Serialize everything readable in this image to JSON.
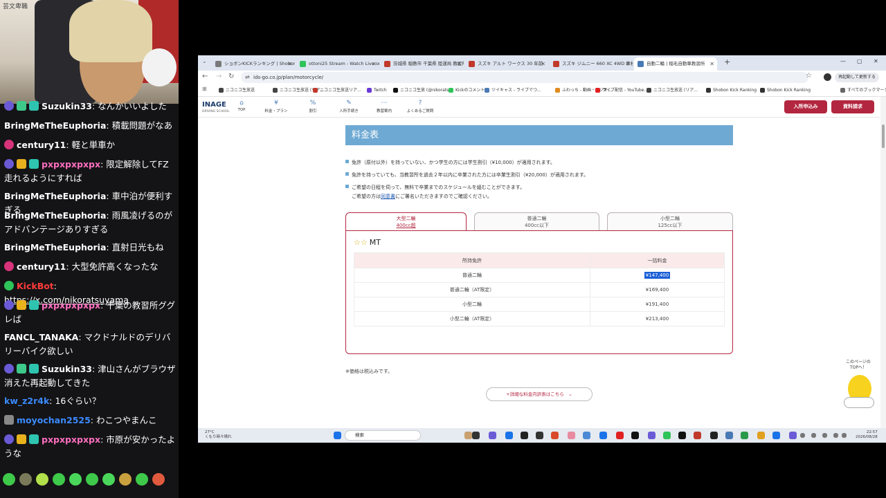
{
  "cam": {
    "tag": "芸文卑職"
  },
  "chat": [
    {
      "top": 0,
      "user": "Suzukin33",
      "text": "なんかいいよした",
      "badges": [
        "#2a8a3a",
        "#8a4ad6"
      ],
      "ucolor": "#ffffff"
    },
    {
      "user": "BringMeTheEuphoria",
      "text": "積載問題がなあ",
      "ucolor": "#ffffff"
    },
    {
      "user": "century11",
      "text": "軽と単車か",
      "ucolor": "#ffffff",
      "circle": "#d6337a"
    },
    {
      "user": "pxpxpxpxpx",
      "text": "限定解除してFZ走れるようにすれば",
      "ucolor": "#ff6fbf"
    },
    {
      "user": "BringMeTheEuphoria",
      "text": "車中泊が便利すぎる",
      "ucolor": "#ffffff"
    },
    {
      "user": "BringMeTheEuphoria",
      "text": "雨風凌げるのがアドバンテージありすぎる",
      "ucolor": "#ffffff"
    },
    {
      "user": "BringMeTheEuphoria",
      "text": "直射日光もね",
      "ucolor": "#ffffff"
    },
    {
      "user": "century11",
      "text": "大型免許高くなったな",
      "ucolor": "#ffffff"
    },
    {
      "user": "KickBot",
      "text": "https://x.com/nikoratsuyama",
      "ucolor": "#ff3b3b"
    },
    {
      "user": "pxpxpxpxpx",
      "text": "千葉の教習所ググレば",
      "ucolor": "#ff6fbf"
    },
    {
      "user": "FANCL_TANAKA",
      "text": "マクドナルドのデリバリーバイク欲しい",
      "ucolor": "#ffffff"
    },
    {
      "user": "Suzukin33",
      "text": "津山さんがブラウザ消えた再起動してきた",
      "ucolor": "#ffffff"
    },
    {
      "user": "kw_z2r4k",
      "text": "16ぐらい？",
      "ucolor": "#3b8bff"
    },
    {
      "user": "moyochan2525",
      "text": "わこつやまんこ",
      "ucolor": "#3b8bff"
    },
    {
      "user": "pxpxpxpxpx",
      "text": "市原が安かったような",
      "ucolor": "#ff6fbf"
    }
  ],
  "browser": {
    "tabs": [
      "ショボンKICKランキング | Shobon Kick",
      "ottoni25 Stream - Watch Live on Kick",
      "茨城県 稲敷市 千葉県 陸運局 教習所",
      "スズキ アルト ワークス 30 年前",
      "スズキ ジムニー 660 XC 4WD 車検",
      "自動二輪 | 稲毛自動車教習所"
    ],
    "url": "ids-go.co.jp/plan/motorcycle/",
    "relaunch": "再起動して更新する",
    "bookmarks": [
      "ニコニコ生放送",
      "ニコニコ生放送 (リア...",
      "ニコニコ生放送リア...",
      "Twitch",
      "ニコニコ生放 (@nikorats...",
      "Kickのコメント",
      "ツイキャス - ライブでつ...",
      "ふわっち - 動画・ラジオ...",
      "ライブ配信 - YouTube...",
      "ニコニコ生放送 (リア...",
      "Shobon Kick Ranking",
      "Shobon Kick Ranking",
      "すべてのブックマーク"
    ],
    "site": {
      "logo": "INAGE",
      "logo_sub": "DRIVING SCHOOL",
      "nav": [
        "TOP",
        "料金・プラン",
        "割引",
        "入所手続き",
        "教習案内",
        "よくあるご質問"
      ],
      "cta_apply": "入所申込み",
      "cta_docs": "資料請求"
    },
    "section_title": "料金表",
    "notes": [
      "免許（原付以外）を持っていない、かつ学生の方には学生割引（¥10,000）が適用されます。",
      "免許を持っていても、当教習所を過去２年以内に卒業された方には卒業生割引（¥20,000）が適用されます。",
      "ご希望の日程を伺って、無料で卒業までのスケジュールを組むことができます。"
    ],
    "note_sub_pre": "ご希望の方は",
    "note_sub_link": "同意書",
    "note_sub_post": "にご署名いただきますのでご確認ください。",
    "plan_tabs": [
      {
        "label": "大型二輪",
        "sub": "400cc超"
      },
      {
        "label": "普通二輪",
        "sub": "400cc以下"
      },
      {
        "label": "小型二輪",
        "sub": "125cc以下"
      }
    ],
    "mt": "MT",
    "table": {
      "headers": [
        "所持免許",
        "一括料金"
      ],
      "rows": [
        [
          "普通二輪",
          "¥147,400"
        ],
        [
          "普通二輪（AT限定）",
          "¥169,400"
        ],
        [
          "小型二輪",
          "¥191,400"
        ],
        [
          "小型二輪（AT限定）",
          "¥213,400"
        ]
      ]
    },
    "tax_note": "※価格は税込みです。",
    "detail_btn": "+詳細な料金内訳表はこちら　⌄",
    "totop": "このページの\nTOPへ！",
    "taskbar": {
      "weather_temp": "27°C",
      "weather_desc": "くもり時々晴れ",
      "search": "検索",
      "time": "22:57",
      "date": "2026/08/28"
    }
  }
}
